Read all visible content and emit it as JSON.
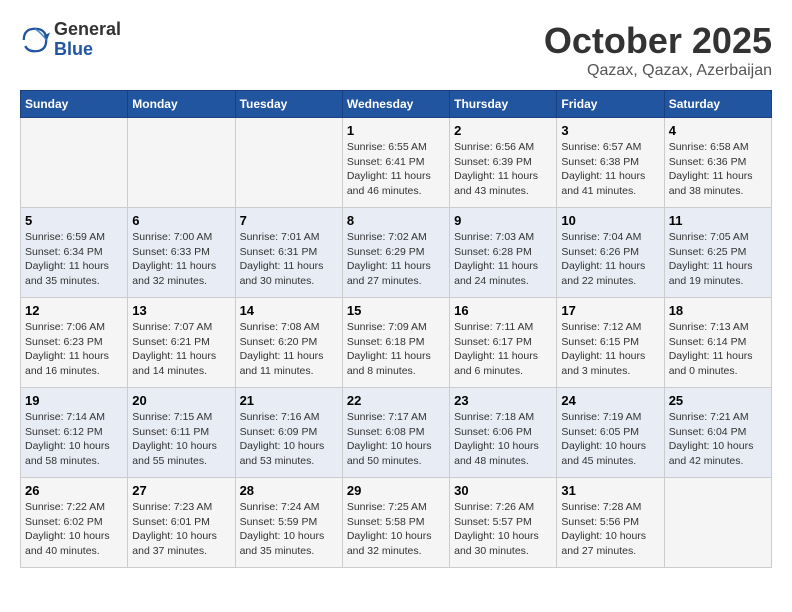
{
  "header": {
    "logo_general": "General",
    "logo_blue": "Blue",
    "title": "October 2025",
    "subtitle": "Qazax, Qazax, Azerbaijan"
  },
  "days_of_week": [
    "Sunday",
    "Monday",
    "Tuesday",
    "Wednesday",
    "Thursday",
    "Friday",
    "Saturday"
  ],
  "weeks": [
    [
      {
        "day": "",
        "info": ""
      },
      {
        "day": "",
        "info": ""
      },
      {
        "day": "",
        "info": ""
      },
      {
        "day": "1",
        "info": "Sunrise: 6:55 AM\nSunset: 6:41 PM\nDaylight: 11 hours\nand 46 minutes."
      },
      {
        "day": "2",
        "info": "Sunrise: 6:56 AM\nSunset: 6:39 PM\nDaylight: 11 hours\nand 43 minutes."
      },
      {
        "day": "3",
        "info": "Sunrise: 6:57 AM\nSunset: 6:38 PM\nDaylight: 11 hours\nand 41 minutes."
      },
      {
        "day": "4",
        "info": "Sunrise: 6:58 AM\nSunset: 6:36 PM\nDaylight: 11 hours\nand 38 minutes."
      }
    ],
    [
      {
        "day": "5",
        "info": "Sunrise: 6:59 AM\nSunset: 6:34 PM\nDaylight: 11 hours\nand 35 minutes."
      },
      {
        "day": "6",
        "info": "Sunrise: 7:00 AM\nSunset: 6:33 PM\nDaylight: 11 hours\nand 32 minutes."
      },
      {
        "day": "7",
        "info": "Sunrise: 7:01 AM\nSunset: 6:31 PM\nDaylight: 11 hours\nand 30 minutes."
      },
      {
        "day": "8",
        "info": "Sunrise: 7:02 AM\nSunset: 6:29 PM\nDaylight: 11 hours\nand 27 minutes."
      },
      {
        "day": "9",
        "info": "Sunrise: 7:03 AM\nSunset: 6:28 PM\nDaylight: 11 hours\nand 24 minutes."
      },
      {
        "day": "10",
        "info": "Sunrise: 7:04 AM\nSunset: 6:26 PM\nDaylight: 11 hours\nand 22 minutes."
      },
      {
        "day": "11",
        "info": "Sunrise: 7:05 AM\nSunset: 6:25 PM\nDaylight: 11 hours\nand 19 minutes."
      }
    ],
    [
      {
        "day": "12",
        "info": "Sunrise: 7:06 AM\nSunset: 6:23 PM\nDaylight: 11 hours\nand 16 minutes."
      },
      {
        "day": "13",
        "info": "Sunrise: 7:07 AM\nSunset: 6:21 PM\nDaylight: 11 hours\nand 14 minutes."
      },
      {
        "day": "14",
        "info": "Sunrise: 7:08 AM\nSunset: 6:20 PM\nDaylight: 11 hours\nand 11 minutes."
      },
      {
        "day": "15",
        "info": "Sunrise: 7:09 AM\nSunset: 6:18 PM\nDaylight: 11 hours\nand 8 minutes."
      },
      {
        "day": "16",
        "info": "Sunrise: 7:11 AM\nSunset: 6:17 PM\nDaylight: 11 hours\nand 6 minutes."
      },
      {
        "day": "17",
        "info": "Sunrise: 7:12 AM\nSunset: 6:15 PM\nDaylight: 11 hours\nand 3 minutes."
      },
      {
        "day": "18",
        "info": "Sunrise: 7:13 AM\nSunset: 6:14 PM\nDaylight: 11 hours\nand 0 minutes."
      }
    ],
    [
      {
        "day": "19",
        "info": "Sunrise: 7:14 AM\nSunset: 6:12 PM\nDaylight: 10 hours\nand 58 minutes."
      },
      {
        "day": "20",
        "info": "Sunrise: 7:15 AM\nSunset: 6:11 PM\nDaylight: 10 hours\nand 55 minutes."
      },
      {
        "day": "21",
        "info": "Sunrise: 7:16 AM\nSunset: 6:09 PM\nDaylight: 10 hours\nand 53 minutes."
      },
      {
        "day": "22",
        "info": "Sunrise: 7:17 AM\nSunset: 6:08 PM\nDaylight: 10 hours\nand 50 minutes."
      },
      {
        "day": "23",
        "info": "Sunrise: 7:18 AM\nSunset: 6:06 PM\nDaylight: 10 hours\nand 48 minutes."
      },
      {
        "day": "24",
        "info": "Sunrise: 7:19 AM\nSunset: 6:05 PM\nDaylight: 10 hours\nand 45 minutes."
      },
      {
        "day": "25",
        "info": "Sunrise: 7:21 AM\nSunset: 6:04 PM\nDaylight: 10 hours\nand 42 minutes."
      }
    ],
    [
      {
        "day": "26",
        "info": "Sunrise: 7:22 AM\nSunset: 6:02 PM\nDaylight: 10 hours\nand 40 minutes."
      },
      {
        "day": "27",
        "info": "Sunrise: 7:23 AM\nSunset: 6:01 PM\nDaylight: 10 hours\nand 37 minutes."
      },
      {
        "day": "28",
        "info": "Sunrise: 7:24 AM\nSunset: 5:59 PM\nDaylight: 10 hours\nand 35 minutes."
      },
      {
        "day": "29",
        "info": "Sunrise: 7:25 AM\nSunset: 5:58 PM\nDaylight: 10 hours\nand 32 minutes."
      },
      {
        "day": "30",
        "info": "Sunrise: 7:26 AM\nSunset: 5:57 PM\nDaylight: 10 hours\nand 30 minutes."
      },
      {
        "day": "31",
        "info": "Sunrise: 7:28 AM\nSunset: 5:56 PM\nDaylight: 10 hours\nand 27 minutes."
      },
      {
        "day": "",
        "info": ""
      }
    ]
  ]
}
